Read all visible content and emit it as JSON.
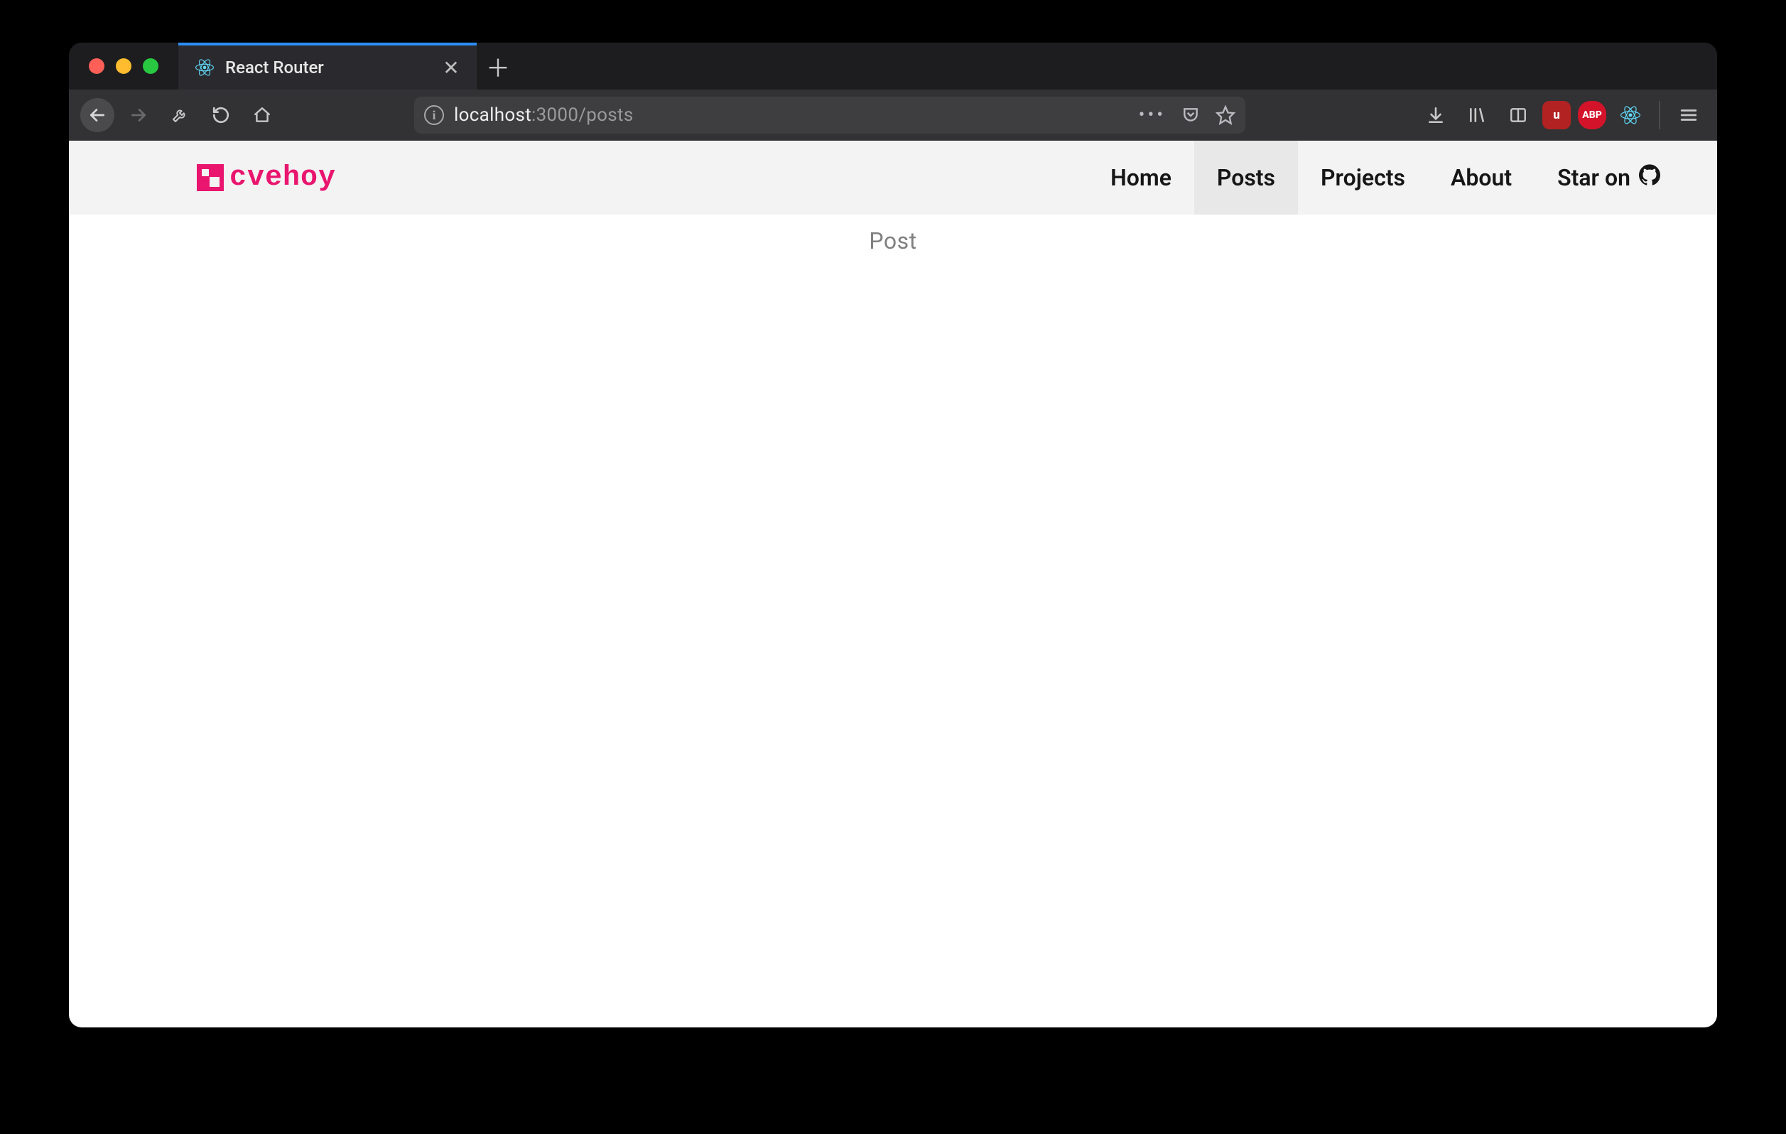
{
  "browser": {
    "tab_title": "React Router",
    "url_host": "localhost",
    "url_path": ":3000/posts"
  },
  "site": {
    "logo_text": "cvehoy",
    "nav": {
      "home": "Home",
      "posts": "Posts",
      "projects": "Projects",
      "about": "About",
      "star": "Star on"
    },
    "active_nav": "posts",
    "body_text": "Post"
  }
}
